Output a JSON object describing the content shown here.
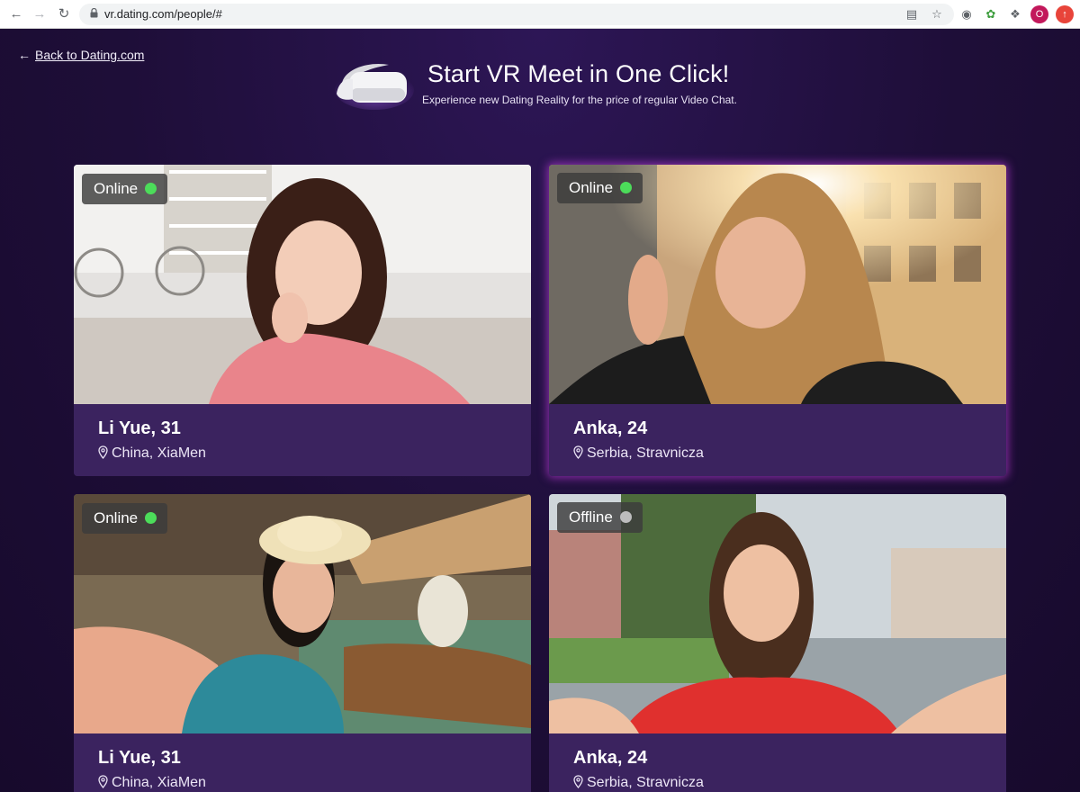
{
  "browser": {
    "url": "vr.dating.com/people/#",
    "profile_initial": "O"
  },
  "page": {
    "back_label": "Back to Dating.com",
    "hero": {
      "title": "Start VR Meet in One Click!",
      "subtitle": "Experience new Dating Reality for the price of regular Video Chat."
    },
    "colors": {
      "background": "#1f0f38",
      "card": "#3b235f",
      "online": "#4cdc5a",
      "offline": "#bdbdbd",
      "glow": "#be3cdc"
    },
    "profiles": [
      {
        "name": "Li Yue, 31",
        "location": "China, XiaMen",
        "status": "Online",
        "online": true
      },
      {
        "name": "Anka, 24",
        "location": "Serbia, Stravnicza",
        "status": "Online",
        "online": true
      },
      {
        "name": "Li Yue, 31",
        "location": "China, XiaMen",
        "status": "Online",
        "online": true
      },
      {
        "name": "Anka, 24",
        "location": "Serbia, Stravnicza",
        "status": "Offline",
        "online": false
      }
    ]
  }
}
